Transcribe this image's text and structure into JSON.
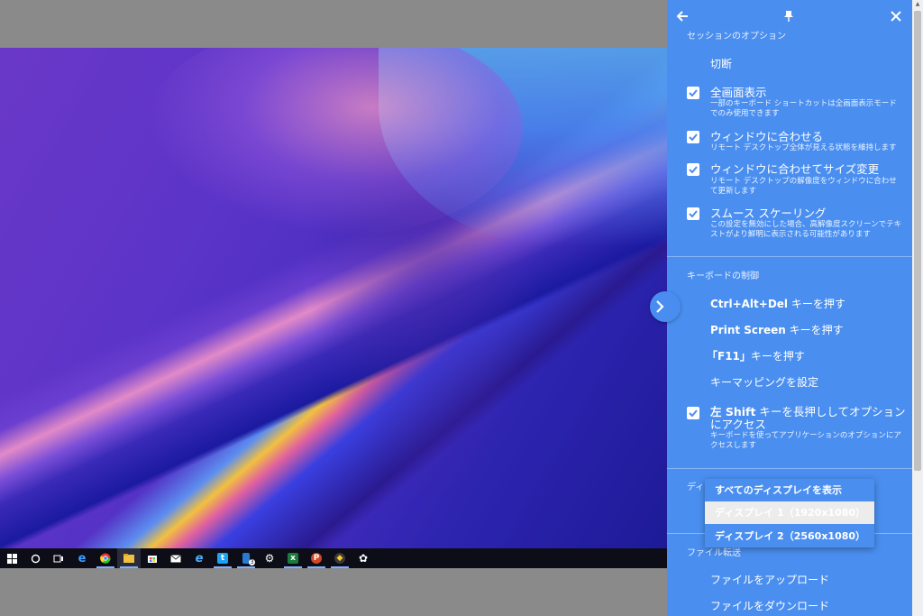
{
  "panel": {
    "session_section": "セッションのオプション",
    "disconnect": "切断",
    "options": [
      {
        "title": "全画面表示",
        "desc": "一部のキーボード ショートカットは全画面表示モードでのみ使用できます",
        "checked": true
      },
      {
        "title": "ウィンドウに合わせる",
        "desc": "リモート デスクトップ全体が見える状態を維持します",
        "checked": true
      },
      {
        "title": "ウィンドウに合わせてサイズ変更",
        "desc": "リモート デスクトップの解像度をウィンドウに合わせて更新します",
        "checked": true
      },
      {
        "title": "スムース スケーリング",
        "desc": "この設定を無効にした場合、高解像度スクリーンでテキストがより鮮明に表示される可能性があります",
        "checked": true
      }
    ],
    "keyboard_section": "キーボードの制御",
    "keyboard_items": [
      {
        "label_bold": "Ctrl+Alt+Del",
        "label_rest": " キーを押す"
      },
      {
        "label_bold": "Print Screen",
        "label_rest": " キーを押す"
      },
      {
        "label_bold": "「F11」",
        "label_rest": "キーを押す"
      },
      {
        "label_bold": "",
        "label_rest": "キーマッピングを設定"
      }
    ],
    "shift_option": {
      "title_bold": "左 Shift",
      "title_rest": " キーを長押ししてオプションにアクセス",
      "desc": "キーボードを使ってアプリケーションのオプションにアクセスします",
      "checked": true
    },
    "display_section_partial": "ディ",
    "display_options": [
      "すべてのディスプレイを表示",
      "ディスプレイ 1（1920x1080）",
      "ディスプレイ 2（2560x1080）"
    ],
    "display_selected_index": 1,
    "file_section": "ファイル転送",
    "file_items": [
      "ファイルをアップロード",
      "ファイルをダウンロード"
    ]
  },
  "taskbar": {
    "icons": [
      "windows-start-icon",
      "cortana-icon",
      "task-view-icon",
      "edge-icon",
      "chrome-icon",
      "file-explorer-icon",
      "store-icon",
      "mail-icon",
      "ie-icon",
      "twitter-icon",
      "phone-icon",
      "settings-icon",
      "excel-icon",
      "powerpoint-icon",
      "davinci-icon",
      "gear-icon"
    ],
    "phone_badge": "3"
  },
  "colors": {
    "panel_bg": "#4a8ff0",
    "taskbar_bg": "#0c0d16",
    "page_bg": "#8a8a8a"
  }
}
